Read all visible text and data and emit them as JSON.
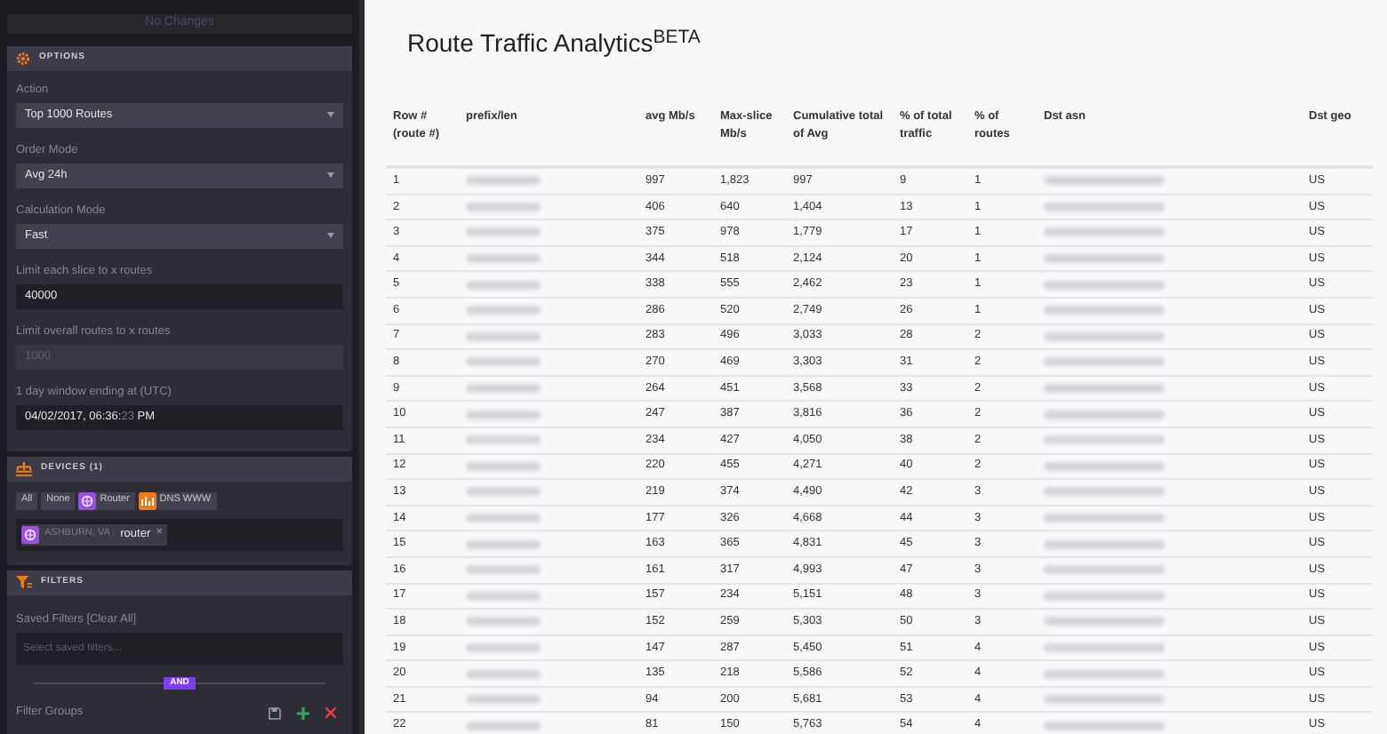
{
  "top_button": {
    "label": "No Changes",
    "disabled": true
  },
  "options": {
    "title": "OPTIONS",
    "fields": [
      {
        "kind": "select",
        "label": "Action",
        "value": "Top 1000 Routes",
        "disabled": false
      },
      {
        "kind": "select",
        "label": "Order Mode",
        "value": "Avg 24h",
        "disabled": false
      },
      {
        "kind": "select",
        "label": "Calculation Mode",
        "value": "Fast",
        "disabled": false
      },
      {
        "kind": "input",
        "label": "Limit each slice to x routes",
        "value": "40000",
        "disabled": false
      },
      {
        "kind": "input",
        "label": "Limit overall routes to x routes",
        "value": "1000",
        "disabled": true
      },
      {
        "kind": "datetime",
        "label": "1 day window ending at (UTC)",
        "value": "04/02/2017, 06:36:",
        "seconds": "23",
        "suffix": "PM",
        "disabled": false
      }
    ]
  },
  "devices": {
    "title": "DEVICES (1)",
    "chips": [
      {
        "kind": "text",
        "label": "All"
      },
      {
        "kind": "text",
        "label": "None"
      },
      {
        "kind": "router",
        "label": "Router"
      },
      {
        "kind": "dns",
        "label": "DNS WWW"
      }
    ],
    "selected": [
      {
        "kind": "router",
        "site": "ASHBURN, VA :",
        "label": "router",
        "remove": "×"
      }
    ]
  },
  "filters": {
    "title": "FILTERS",
    "saved_label": "Saved Filters [Clear All]",
    "placeholder": "Select saved filters...",
    "connector": "AND",
    "groups_label": "Filter Groups"
  },
  "title": "Route Traffic Analytics$^{BETA}$",
  "table": {
    "columns": [
      "Row # (route #)",
      "prefix/len",
      "avg Mb/s",
      "Max-slice Mb/s",
      "Cumulative total of Avg",
      "% of total traffic",
      "% of routes",
      "Dst asn",
      "Dst geo"
    ],
    "rows": [
      [
        "1",
        null,
        "997",
        "1,823",
        "997",
        "9",
        "1",
        null,
        "US"
      ],
      [
        "2",
        null,
        "406",
        "640",
        "1,404",
        "13",
        "1",
        null,
        "US"
      ],
      [
        "3",
        null,
        "375",
        "978",
        "1,779",
        "17",
        "1",
        null,
        "US"
      ],
      [
        "4",
        null,
        "344",
        "518",
        "2,124",
        "20",
        "1",
        null,
        "US"
      ],
      [
        "5",
        null,
        "338",
        "555",
        "2,462",
        "23",
        "1",
        null,
        "US"
      ],
      [
        "6",
        null,
        "286",
        "520",
        "2,749",
        "26",
        "1",
        null,
        "US"
      ],
      [
        "7",
        null,
        "283",
        "496",
        "3,033",
        "28",
        "2",
        null,
        "US"
      ],
      [
        "8",
        null,
        "270",
        "469",
        "3,303",
        "31",
        "2",
        null,
        "US"
      ],
      [
        "9",
        null,
        "264",
        "451",
        "3,568",
        "33",
        "2",
        null,
        "US"
      ],
      [
        "10",
        null,
        "247",
        "387",
        "3,816",
        "36",
        "2",
        null,
        "US"
      ],
      [
        "11",
        null,
        "234",
        "427",
        "4,050",
        "38",
        "2",
        null,
        "US"
      ],
      [
        "12",
        null,
        "220",
        "455",
        "4,271",
        "40",
        "2",
        null,
        "US"
      ],
      [
        "13",
        null,
        "219",
        "374",
        "4,490",
        "42",
        "3",
        null,
        "US"
      ],
      [
        "14",
        null,
        "177",
        "326",
        "4,668",
        "44",
        "3",
        null,
        "US"
      ],
      [
        "15",
        null,
        "163",
        "365",
        "4,831",
        "45",
        "3",
        null,
        "US"
      ],
      [
        "16",
        null,
        "161",
        "317",
        "4,993",
        "47",
        "3",
        null,
        "US"
      ],
      [
        "17",
        null,
        "157",
        "234",
        "5,151",
        "48",
        "3",
        null,
        "US"
      ],
      [
        "18",
        null,
        "152",
        "259",
        "5,303",
        "50",
        "3",
        null,
        "US"
      ],
      [
        "19",
        null,
        "147",
        "287",
        "5,450",
        "51",
        "4",
        null,
        "US"
      ],
      [
        "20",
        null,
        "135",
        "218",
        "5,586",
        "52",
        "4",
        null,
        "US"
      ],
      [
        "21",
        null,
        "94",
        "200",
        "5,681",
        "53",
        "4",
        null,
        "US"
      ],
      [
        "22",
        null,
        "81",
        "150",
        "5,763",
        "54",
        "4",
        null,
        "US"
      ]
    ]
  }
}
